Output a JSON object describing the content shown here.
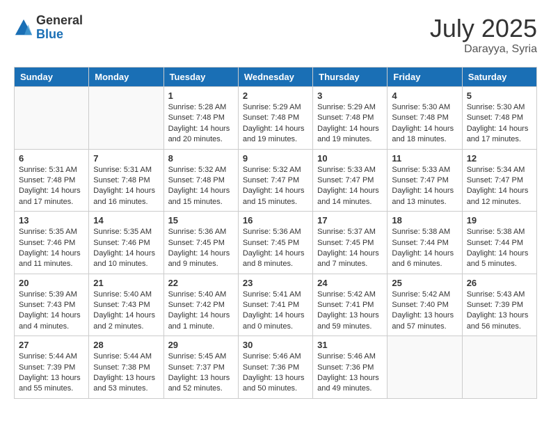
{
  "header": {
    "logo_general": "General",
    "logo_blue": "Blue",
    "month_year": "July 2025",
    "location": "Darayya, Syria"
  },
  "weekdays": [
    "Sunday",
    "Monday",
    "Tuesday",
    "Wednesday",
    "Thursday",
    "Friday",
    "Saturday"
  ],
  "weeks": [
    [
      {
        "day": "",
        "content": ""
      },
      {
        "day": "",
        "content": ""
      },
      {
        "day": "1",
        "content": "Sunrise: 5:28 AM\nSunset: 7:48 PM\nDaylight: 14 hours\nand 20 minutes."
      },
      {
        "day": "2",
        "content": "Sunrise: 5:29 AM\nSunset: 7:48 PM\nDaylight: 14 hours\nand 19 minutes."
      },
      {
        "day": "3",
        "content": "Sunrise: 5:29 AM\nSunset: 7:48 PM\nDaylight: 14 hours\nand 19 minutes."
      },
      {
        "day": "4",
        "content": "Sunrise: 5:30 AM\nSunset: 7:48 PM\nDaylight: 14 hours\nand 18 minutes."
      },
      {
        "day": "5",
        "content": "Sunrise: 5:30 AM\nSunset: 7:48 PM\nDaylight: 14 hours\nand 17 minutes."
      }
    ],
    [
      {
        "day": "6",
        "content": "Sunrise: 5:31 AM\nSunset: 7:48 PM\nDaylight: 14 hours\nand 17 minutes."
      },
      {
        "day": "7",
        "content": "Sunrise: 5:31 AM\nSunset: 7:48 PM\nDaylight: 14 hours\nand 16 minutes."
      },
      {
        "day": "8",
        "content": "Sunrise: 5:32 AM\nSunset: 7:48 PM\nDaylight: 14 hours\nand 15 minutes."
      },
      {
        "day": "9",
        "content": "Sunrise: 5:32 AM\nSunset: 7:47 PM\nDaylight: 14 hours\nand 15 minutes."
      },
      {
        "day": "10",
        "content": "Sunrise: 5:33 AM\nSunset: 7:47 PM\nDaylight: 14 hours\nand 14 minutes."
      },
      {
        "day": "11",
        "content": "Sunrise: 5:33 AM\nSunset: 7:47 PM\nDaylight: 14 hours\nand 13 minutes."
      },
      {
        "day": "12",
        "content": "Sunrise: 5:34 AM\nSunset: 7:47 PM\nDaylight: 14 hours\nand 12 minutes."
      }
    ],
    [
      {
        "day": "13",
        "content": "Sunrise: 5:35 AM\nSunset: 7:46 PM\nDaylight: 14 hours\nand 11 minutes."
      },
      {
        "day": "14",
        "content": "Sunrise: 5:35 AM\nSunset: 7:46 PM\nDaylight: 14 hours\nand 10 minutes."
      },
      {
        "day": "15",
        "content": "Sunrise: 5:36 AM\nSunset: 7:45 PM\nDaylight: 14 hours\nand 9 minutes."
      },
      {
        "day": "16",
        "content": "Sunrise: 5:36 AM\nSunset: 7:45 PM\nDaylight: 14 hours\nand 8 minutes."
      },
      {
        "day": "17",
        "content": "Sunrise: 5:37 AM\nSunset: 7:45 PM\nDaylight: 14 hours\nand 7 minutes."
      },
      {
        "day": "18",
        "content": "Sunrise: 5:38 AM\nSunset: 7:44 PM\nDaylight: 14 hours\nand 6 minutes."
      },
      {
        "day": "19",
        "content": "Sunrise: 5:38 AM\nSunset: 7:44 PM\nDaylight: 14 hours\nand 5 minutes."
      }
    ],
    [
      {
        "day": "20",
        "content": "Sunrise: 5:39 AM\nSunset: 7:43 PM\nDaylight: 14 hours\nand 4 minutes."
      },
      {
        "day": "21",
        "content": "Sunrise: 5:40 AM\nSunset: 7:43 PM\nDaylight: 14 hours\nand 2 minutes."
      },
      {
        "day": "22",
        "content": "Sunrise: 5:40 AM\nSunset: 7:42 PM\nDaylight: 14 hours\nand 1 minute."
      },
      {
        "day": "23",
        "content": "Sunrise: 5:41 AM\nSunset: 7:41 PM\nDaylight: 14 hours\nand 0 minutes."
      },
      {
        "day": "24",
        "content": "Sunrise: 5:42 AM\nSunset: 7:41 PM\nDaylight: 13 hours\nand 59 minutes."
      },
      {
        "day": "25",
        "content": "Sunrise: 5:42 AM\nSunset: 7:40 PM\nDaylight: 13 hours\nand 57 minutes."
      },
      {
        "day": "26",
        "content": "Sunrise: 5:43 AM\nSunset: 7:39 PM\nDaylight: 13 hours\nand 56 minutes."
      }
    ],
    [
      {
        "day": "27",
        "content": "Sunrise: 5:44 AM\nSunset: 7:39 PM\nDaylight: 13 hours\nand 55 minutes."
      },
      {
        "day": "28",
        "content": "Sunrise: 5:44 AM\nSunset: 7:38 PM\nDaylight: 13 hours\nand 53 minutes."
      },
      {
        "day": "29",
        "content": "Sunrise: 5:45 AM\nSunset: 7:37 PM\nDaylight: 13 hours\nand 52 minutes."
      },
      {
        "day": "30",
        "content": "Sunrise: 5:46 AM\nSunset: 7:36 PM\nDaylight: 13 hours\nand 50 minutes."
      },
      {
        "day": "31",
        "content": "Sunrise: 5:46 AM\nSunset: 7:36 PM\nDaylight: 13 hours\nand 49 minutes."
      },
      {
        "day": "",
        "content": ""
      },
      {
        "day": "",
        "content": ""
      }
    ]
  ]
}
